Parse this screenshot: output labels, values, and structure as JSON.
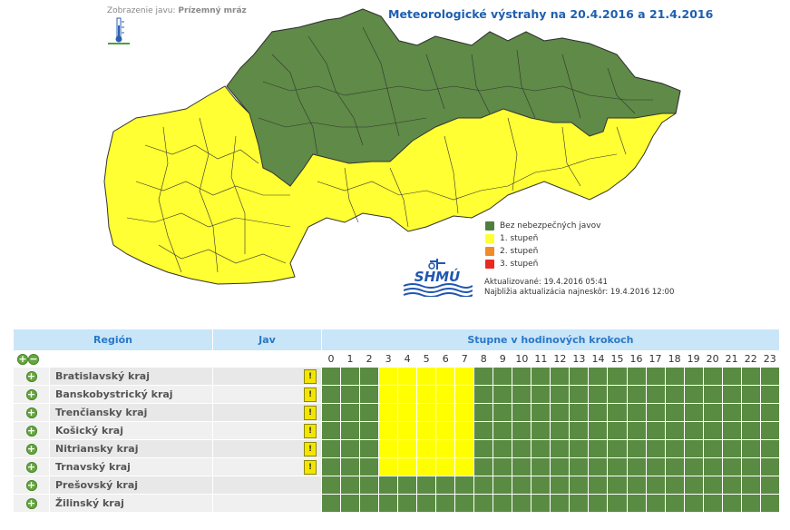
{
  "header": {
    "display_label": "Zobrazenie javu:",
    "display_value": "Prízemný mráz",
    "title": "Meteorologické výstrahy na 20.4.2016  a 21.4.2016"
  },
  "legend": {
    "items": [
      {
        "label": "Bez nebezpečných javov",
        "color": "#4f7f3f"
      },
      {
        "label": "1. stupeň",
        "color": "#ffff33"
      },
      {
        "label": "2. stupeň",
        "color": "#f08a2a"
      },
      {
        "label": "3. stupeň",
        "color": "#e82a20"
      }
    ]
  },
  "logo": {
    "text": "SHMÚ"
  },
  "update": {
    "updated": "Aktualizované: 19.4.2016 05:41",
    "next": "Najbližia aktualizácia najneskôr: 19.4.2016 12:00"
  },
  "table": {
    "col_region": "Región",
    "col_jav": "Jav",
    "col_steps": "Stupne v hodinových krokoch",
    "hours": [
      "0",
      "1",
      "2",
      "3",
      "4",
      "5",
      "6",
      "7",
      "8",
      "9",
      "10",
      "11",
      "12",
      "13",
      "14",
      "15",
      "16",
      "17",
      "18",
      "19",
      "20",
      "21",
      "22",
      "23"
    ],
    "rows": [
      {
        "region": "Bratislavský kraj",
        "has_warning": true,
        "levels": [
          0,
          0,
          0,
          1,
          1,
          1,
          1,
          1,
          0,
          0,
          0,
          0,
          0,
          0,
          0,
          0,
          0,
          0,
          0,
          0,
          0,
          0,
          0,
          0
        ]
      },
      {
        "region": "Banskobystrický kraj",
        "has_warning": true,
        "levels": [
          0,
          0,
          0,
          1,
          1,
          1,
          1,
          1,
          0,
          0,
          0,
          0,
          0,
          0,
          0,
          0,
          0,
          0,
          0,
          0,
          0,
          0,
          0,
          0
        ]
      },
      {
        "region": "Trenčiansky kraj",
        "has_warning": true,
        "levels": [
          0,
          0,
          0,
          1,
          1,
          1,
          1,
          1,
          0,
          0,
          0,
          0,
          0,
          0,
          0,
          0,
          0,
          0,
          0,
          0,
          0,
          0,
          0,
          0
        ]
      },
      {
        "region": "Košický kraj",
        "has_warning": true,
        "levels": [
          0,
          0,
          0,
          1,
          1,
          1,
          1,
          1,
          0,
          0,
          0,
          0,
          0,
          0,
          0,
          0,
          0,
          0,
          0,
          0,
          0,
          0,
          0,
          0
        ]
      },
      {
        "region": "Nitriansky kraj",
        "has_warning": true,
        "levels": [
          0,
          0,
          0,
          1,
          1,
          1,
          1,
          1,
          0,
          0,
          0,
          0,
          0,
          0,
          0,
          0,
          0,
          0,
          0,
          0,
          0,
          0,
          0,
          0
        ]
      },
      {
        "region": "Trnavský kraj",
        "has_warning": true,
        "levels": [
          0,
          0,
          0,
          1,
          1,
          1,
          1,
          1,
          0,
          0,
          0,
          0,
          0,
          0,
          0,
          0,
          0,
          0,
          0,
          0,
          0,
          0,
          0,
          0
        ]
      },
      {
        "region": "Prešovský kraj",
        "has_warning": false,
        "levels": [
          0,
          0,
          0,
          0,
          0,
          0,
          0,
          0,
          0,
          0,
          0,
          0,
          0,
          0,
          0,
          0,
          0,
          0,
          0,
          0,
          0,
          0,
          0,
          0
        ]
      },
      {
        "region": "Žilinský kraj",
        "has_warning": false,
        "levels": [
          0,
          0,
          0,
          0,
          0,
          0,
          0,
          0,
          0,
          0,
          0,
          0,
          0,
          0,
          0,
          0,
          0,
          0,
          0,
          0,
          0,
          0,
          0,
          0
        ]
      }
    ],
    "warning_icon_glyph": "!",
    "expand_glyph": "+",
    "collapse_glyph": "−",
    "level_colors": [
      "#5a8b42",
      "#ffff00"
    ]
  },
  "map": {
    "green_color": "#5f8a47",
    "yellow_color": "#ffff33",
    "border_color": "#333333"
  }
}
